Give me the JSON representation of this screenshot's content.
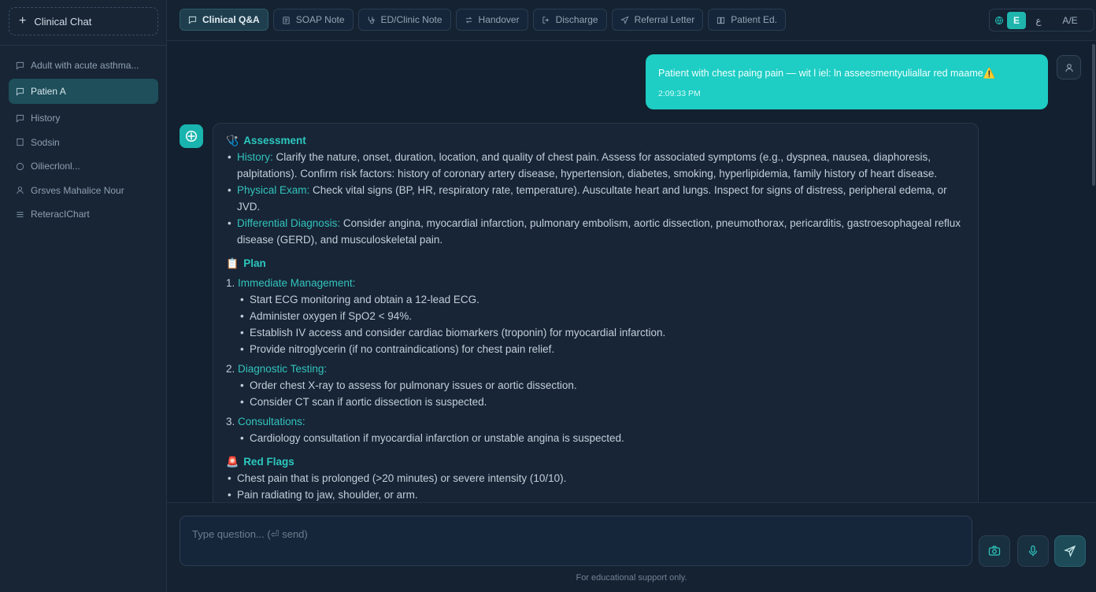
{
  "sidebar": {
    "new_chat_label": "Clinical Chat",
    "items": [
      {
        "label": "Adult with acute asthma...",
        "active": false
      },
      {
        "label": "Patien A",
        "active": true
      },
      {
        "label": "History",
        "active": false
      },
      {
        "label": "Sodsin",
        "active": false
      },
      {
        "label": "Oiliecrlonl...",
        "active": false
      },
      {
        "label": "Grsves Mahalice Nour",
        "active": false
      },
      {
        "label": "ReteracIChart",
        "active": false
      }
    ]
  },
  "tabs": [
    {
      "label": "Clinical Q&A",
      "icon": "chat-icon",
      "active": true
    },
    {
      "label": "SOAP Note",
      "icon": "clipboard-icon",
      "active": false
    },
    {
      "label": "ED/Clinic Note",
      "icon": "stethoscope-icon",
      "active": false
    },
    {
      "label": "Handover",
      "icon": "swap-icon",
      "active": false
    },
    {
      "label": "Discharge",
      "icon": "exit-icon",
      "active": false
    },
    {
      "label": "Referral Letter",
      "icon": "send-icon",
      "active": false
    },
    {
      "label": "Patient Ed.",
      "icon": "book-icon",
      "active": false
    }
  ],
  "language": {
    "icon": "globe-icon",
    "options": [
      "E",
      "ع",
      "A/E"
    ],
    "selected": "E"
  },
  "user_message": {
    "text": "Patient with chest paing pain — wit l iel: ln asseesmentyuliallar red maame⚠️",
    "time": "2:09:33 PM"
  },
  "answer": {
    "assessment": {
      "emoji": "🩺",
      "title": "Assessment",
      "items": [
        {
          "label": "History:",
          "text": " Clarify the nature, onset, duration, location, and quality of chest pain. Assess for associated symptoms (e.g., dyspnea, nausea, diaphoresis, palpitations). Confirm risk factors: history of coronary artery disease, hypertension, diabetes, smoking, hyperlipidemia, family history of heart disease."
        },
        {
          "label": "Physical Exam:",
          "text": " Check vital signs (BP, HR, respiratory rate, temperature). Auscultate heart and lungs. Inspect for signs of distress, peripheral edema, or JVD."
        },
        {
          "label": "Differential Diagnosis:",
          "text": " Consider angina, myocardial infarction, pulmonary embolism, aortic dissection, pneumothorax, pericarditis, gastroesophageal reflux disease (GERD), and musculoskeletal pain."
        }
      ]
    },
    "plan": {
      "emoji": "📋",
      "title": "Plan",
      "steps": [
        {
          "num": "1.",
          "title": "Immediate Management:",
          "items": [
            "Start ECG monitoring and obtain a 12-lead ECG.",
            "Administer oxygen if SpO2 < 94%.",
            "Establish IV access and consider cardiac biomarkers (troponin) for myocardial infarction.",
            "Provide nitroglycerin (if no contraindications) for chest pain relief."
          ]
        },
        {
          "num": "2.",
          "title": "Diagnostic Testing:",
          "items": [
            "Order chest X-ray to assess for pulmonary issues or aortic dissection.",
            "Consider CT scan if aortic dissection is suspected."
          ]
        },
        {
          "num": "3.",
          "title": "Consultations:",
          "items": [
            "Cardiology consultation if myocardial infarction or unstable angina is suspected."
          ]
        }
      ]
    },
    "red_flags": {
      "emoji": "🚨",
      "title": "Red Flags",
      "items": [
        "Chest pain that is prolonged (>20 minutes) or severe intensity (10/10).",
        "Pain radiating to jaw, shoulder, or arm."
      ]
    }
  },
  "composer": {
    "placeholder": "Type question... (⏎ send)",
    "footer": "For educational support only."
  },
  "colors": {
    "accent": "#1ecdc4",
    "background": "#13202f",
    "panel": "#172536"
  }
}
